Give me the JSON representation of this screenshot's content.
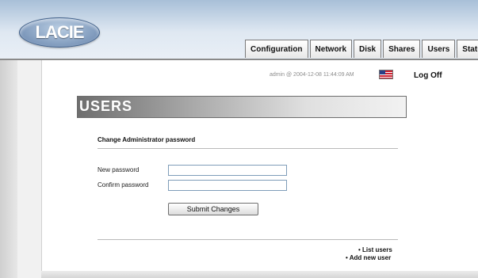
{
  "header": {
    "logo_text": "LACIE",
    "tabs": [
      "Configuration",
      "Network",
      "Disk",
      "Shares",
      "Users",
      "Status"
    ]
  },
  "status": {
    "info": "admin @ 2004-12-08 11:44:09 AM",
    "flag_icon": "us-flag-icon",
    "logoff_label": "Log Off"
  },
  "page": {
    "title": "USERS",
    "section_title": "Change Administrator password"
  },
  "form": {
    "new_password_label": "New password",
    "confirm_password_label": "Confirm password",
    "new_password_value": "",
    "confirm_password_value": "",
    "submit_label": "Submit Changes"
  },
  "links": {
    "list_users": "• List users",
    "add_new_user": "• Add new user"
  }
}
